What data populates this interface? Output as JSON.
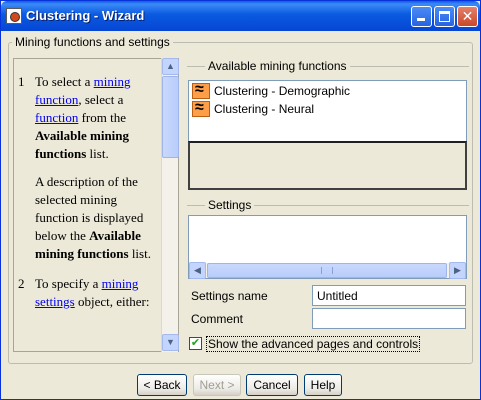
{
  "window": {
    "title": "Clustering - Wizard"
  },
  "title_buttons": {
    "minimize": "minimize",
    "maximize": "maximize",
    "close": "✕"
  },
  "group": {
    "legend": "Mining functions and settings"
  },
  "help": {
    "item1": {
      "num": "1",
      "text_a": "To select a ",
      "link1": "mining function",
      "text_b": ",  select a ",
      "link2": "function",
      "text_c": " from the ",
      "bold1": "Available mining functions",
      "text_d": " list."
    },
    "para2": {
      "text_a": "A description of the selected mining function is displayed below the ",
      "bold1": "Available mining functions",
      "text_b": " list."
    },
    "item2": {
      "num": "2",
      "text_a": "To specify a ",
      "link1": "mining settings",
      "text_b": " object, either:"
    }
  },
  "available": {
    "legend": "Available mining functions",
    "items": [
      {
        "label": "Clustering - Demographic",
        "icon": "clustering-icon"
      },
      {
        "label": "Clustering - Neural",
        "icon": "clustering-icon"
      }
    ]
  },
  "settings": {
    "legend": "Settings",
    "name_label": "Settings name",
    "name_value": "Untitled",
    "comment_label": "Comment",
    "comment_value": ""
  },
  "advanced": {
    "label": "Show the advanced pages and controls",
    "checked": true,
    "check_glyph": "✔"
  },
  "buttons": {
    "back": "< Back",
    "next": "Next >",
    "cancel": "Cancel",
    "help": "Help"
  },
  "scroll": {
    "up": "▲",
    "down": "▼",
    "left": "◀",
    "right": "▶"
  }
}
